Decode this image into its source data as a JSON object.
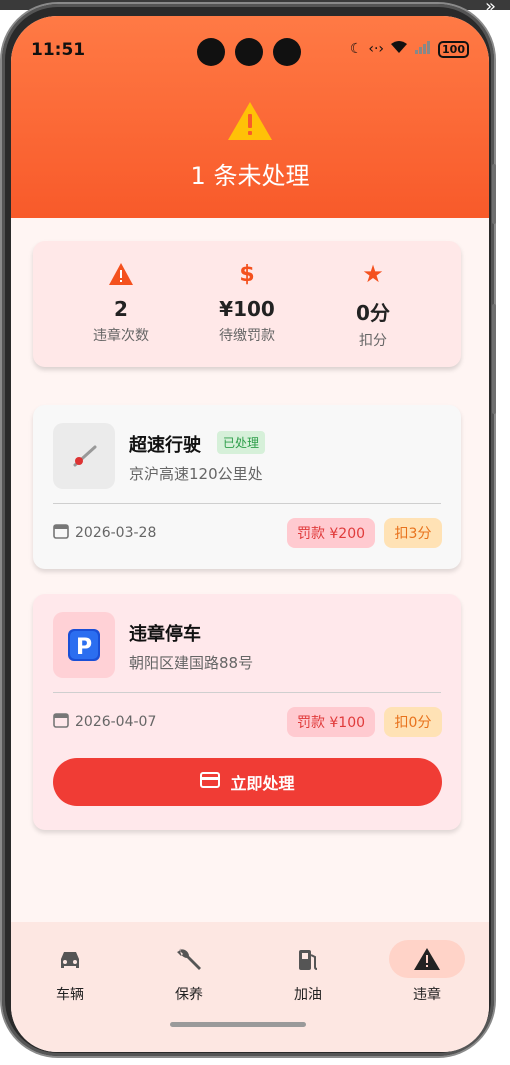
{
  "status_bar": {
    "time": "11:51",
    "battery": "100"
  },
  "header": {
    "title": "1 条未处理"
  },
  "summary": [
    {
      "icon": "warning-icon",
      "value": "2",
      "label": "违章次数"
    },
    {
      "icon": "dollar-icon",
      "value": "¥100",
      "label": "待缴罚款"
    },
    {
      "icon": "star-icon",
      "value": "0分",
      "label": "扣分"
    }
  ],
  "violations": [
    {
      "type": "超速行驶",
      "status": "已处理",
      "location": "京沪高速120公里处",
      "date": "2026-03-28",
      "fine": "罚款 ¥200",
      "points": "扣3分",
      "icon": "speed-gauge-icon"
    },
    {
      "type": "违章停车",
      "location": "朝阳区建国路88号",
      "date": "2026-04-07",
      "fine": "罚款 ¥100",
      "points": "扣0分",
      "icon": "parking-icon",
      "action_label": "立即处理"
    }
  ],
  "nav": [
    {
      "label": "车辆",
      "icon": "car-icon"
    },
    {
      "label": "保养",
      "icon": "wrench-icon"
    },
    {
      "label": "加油",
      "icon": "fuel-icon"
    },
    {
      "label": "违章",
      "icon": "warning-icon",
      "active": true
    }
  ],
  "colors": {
    "header_gradient_top": "#ff7a45",
    "header_gradient_bottom": "#f85a2a",
    "accent_orange": "#f4511e",
    "button_red": "#f03c35",
    "success_green": "#2e9e4a"
  }
}
